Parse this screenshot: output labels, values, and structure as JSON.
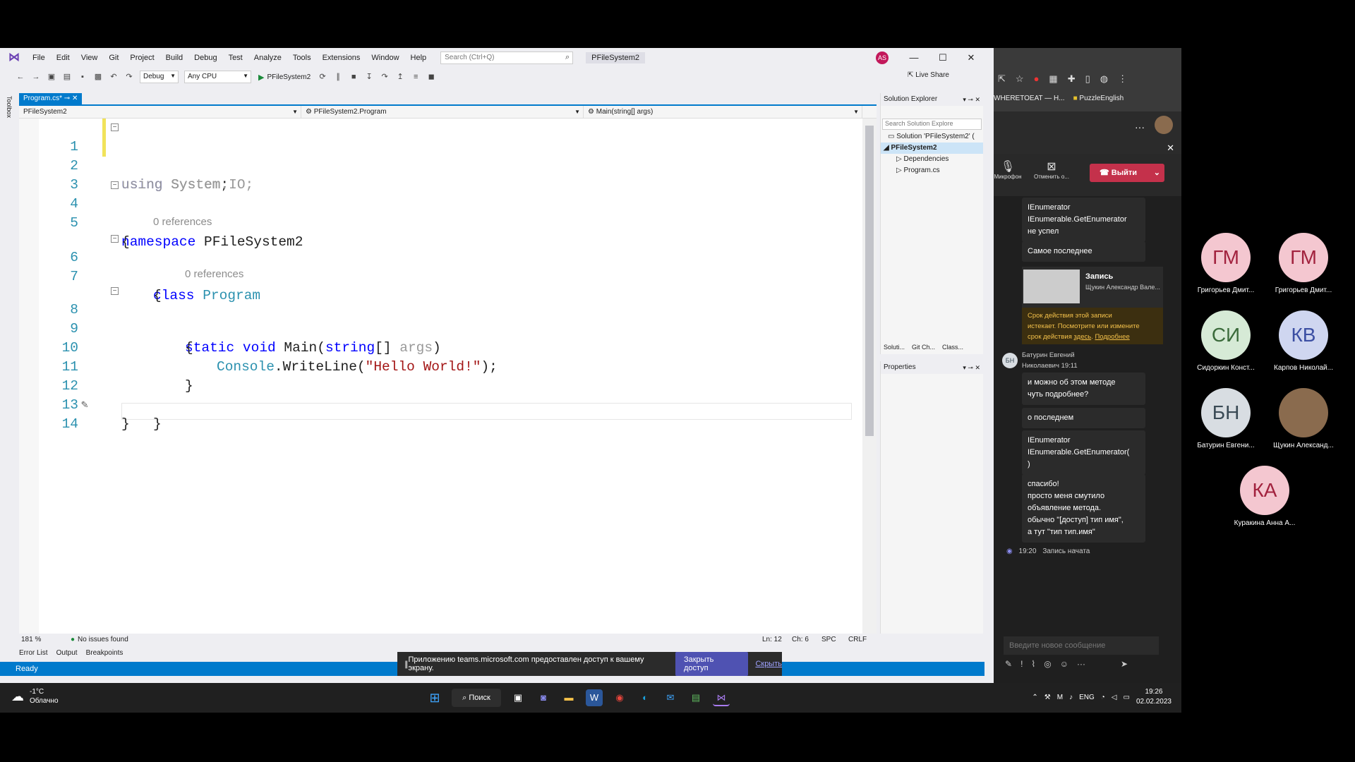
{
  "vs": {
    "menu": [
      "File",
      "Edit",
      "View",
      "Git",
      "Project",
      "Build",
      "Debug",
      "Test",
      "Analyze",
      "Tools",
      "Extensions",
      "Window",
      "Help"
    ],
    "search_placeholder": "Search (Ctrl+Q)",
    "solution_name": "PFileSystem2",
    "user_initials": "AS",
    "toolbar": {
      "config": "Debug",
      "platform": "Any CPU",
      "start_target": "PFileSystem2",
      "live_share": "Live Share"
    },
    "toolbox_label": "Toolbox",
    "tab": "Program.cs*",
    "nav": {
      "project": "PFileSystem2",
      "class": "PFileSystem2.Program",
      "member": "Main(string[] args)"
    },
    "code": {
      "line_numbers": [
        "1",
        "2",
        "3",
        "4",
        "5",
        "6",
        "7",
        "8",
        "9",
        "10",
        "11",
        "12",
        "13",
        "14"
      ],
      "references_label": "0 references",
      "l1": {
        "kw": "using",
        "rest": " System;"
      },
      "l2": "using System.IO;",
      "l4": {
        "kw": "namespace",
        "rest": " PFileSystem2"
      },
      "brace_open": "{",
      "brace_close": "}",
      "l6": {
        "kw": "class",
        "type": "Program"
      },
      "l8": {
        "kw1": "static",
        "kw2": "void",
        "name": " Main(",
        "kw3": "string",
        "rest": "[] ",
        "param": "args",
        "close": ")"
      },
      "l10": {
        "type": "Console",
        "method": ".WriteLine(",
        "str": "\"Hello World!\"",
        "end": ");"
      }
    },
    "status": {
      "zoom": "181 %",
      "issues": "No issues found",
      "ln": "Ln: 12",
      "ch": "Ch: 6",
      "spc": "SPC",
      "crlf": "CRLF"
    },
    "tool_tabs": [
      "Error List",
      "Output",
      "Breakpoints"
    ],
    "ready": "Ready",
    "solution_explorer": {
      "title": "Solution Explorer",
      "search": "Search Solution Explore",
      "items": [
        "Solution 'PFileSystem2' (",
        "PFileSystem2",
        "Dependencies",
        "Program.cs"
      ],
      "bottom_tabs": [
        "Soluti...",
        "Git Ch...",
        "Class..."
      ]
    },
    "properties_title": "Properties"
  },
  "share_banner": {
    "text": "Приложению teams.microsoft.com предоставлен доступ к вашему экрану.",
    "button": "Закрыть доступ",
    "hide": "Скрыть"
  },
  "taskbar": {
    "temp": "-1°C",
    "weather": "Облачно",
    "search": "Поиск",
    "lang": "ENG",
    "time": "19:26",
    "date": "02.02.2023"
  },
  "browser": {
    "bookmark1": "WHERETOEAT — H...",
    "bookmark2": "PuzzleEnglish"
  },
  "teams": {
    "mic": "Микрофон",
    "cancel": "Отменить о...",
    "leave": "Выйти",
    "messages": {
      "m1": [
        "IEnumerator",
        "IEnumerable.GetEnumerator",
        "не успел"
      ],
      "m2": "Самое последнее",
      "recording_title": "Запись",
      "recording_author": "Щукин Александр Вале...",
      "expiry": [
        "Срок действия этой записи",
        "истекает. Посмотрите или измените",
        "срок действия"
      ],
      "expiry_link1": "здесь",
      "expiry_link2": "Подробнее",
      "author_initials": "БН",
      "author": [
        "Батурин Евгений",
        "Николаевич"
      ],
      "author_time": "19:11",
      "m3": [
        "и можно об этом методе",
        "чуть подробнее?"
      ],
      "m4": "о последнем",
      "m5": [
        "IEnumerator",
        "IEnumerable.GetEnumerator(",
        ")"
      ],
      "m6": [
        "спасибо!",
        "просто меня смутило",
        "объявление метода.",
        "обычно \"[доступ] тип имя\",",
        "а тут \"тип тип.имя\""
      ],
      "event_time": "19:20",
      "event": "Запись начата"
    },
    "compose_placeholder": "Введите новое сообщение"
  },
  "participants": [
    {
      "initials": "ГМ",
      "name": "Григорьев Дмит..."
    },
    {
      "initials": "ГМ",
      "name": "Григорьев Дмит..."
    },
    {
      "initials": "СИ",
      "name": "Сидоркин Конст..."
    },
    {
      "initials": "КВ",
      "name": "Карпов Николай..."
    },
    {
      "initials": "БН",
      "name": "Батурин Евгени..."
    },
    {
      "initials": "",
      "name": "Щукин Александ..."
    },
    {
      "initials": "КА",
      "name": "Куракина Анна А..."
    }
  ]
}
